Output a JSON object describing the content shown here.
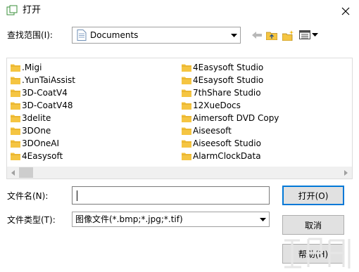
{
  "titlebar": {
    "title": "打开"
  },
  "look_in": {
    "label": "查找范围(I):",
    "value": "Documents"
  },
  "file_list": {
    "column_1": [
      ".Migi",
      ".YunTaiAssist",
      "3D-CoatV4",
      "3D-CoatV48",
      "3delite",
      "3DOne",
      "3DOneAI",
      "4Easysoft"
    ],
    "column_2": [
      "4Easysoft Studio",
      "4Esaysoft Studio",
      "7thShare Studio",
      "12XueDocs",
      "Aimersoft DVD Copy",
      "Aiseesoft",
      "Aiseesoft Studio",
      "AlarmClockData"
    ]
  },
  "file_name": {
    "label": "文件名(N):",
    "value": ""
  },
  "file_type": {
    "label": "文件类型(T):",
    "value": "图像文件(*.bmp;*.jpg;*.tif)"
  },
  "buttons": {
    "open": "打开(O)",
    "cancel": "取消",
    "help": "帮助(H)"
  },
  "colors": {
    "folder": "#f5c542",
    "accent": "#0078d7",
    "button_bg": "#e1e1e1"
  }
}
